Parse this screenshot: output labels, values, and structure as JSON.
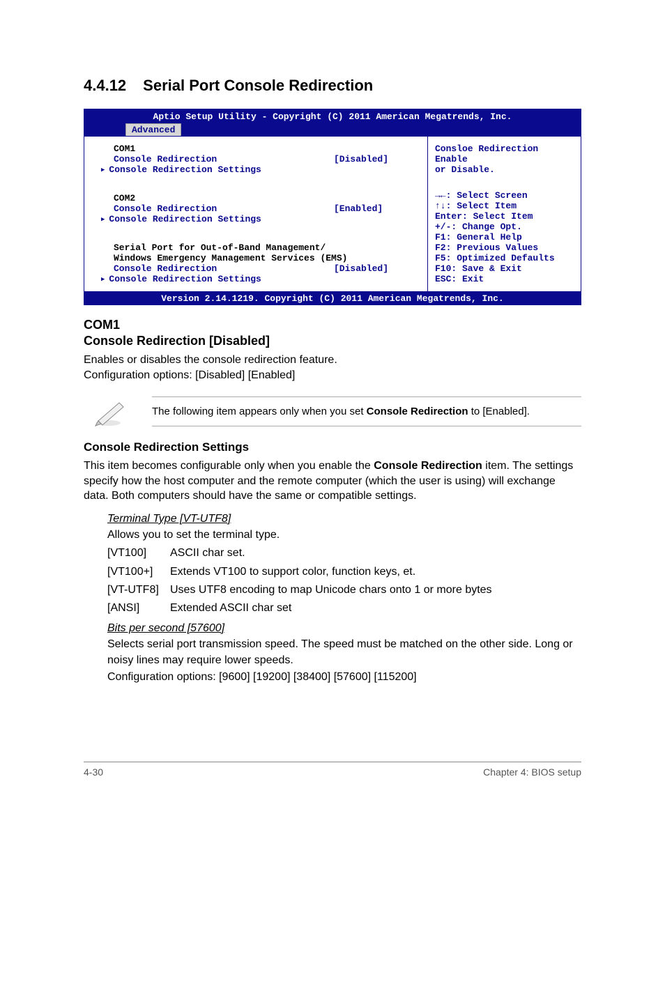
{
  "heading": {
    "num": "4.4.12",
    "title": "Serial Port Console Redirection"
  },
  "bios": {
    "header_title": "Aptio Setup Utility - Copyright (C) 2011 American Megatrends, Inc.",
    "tab": "Advanced",
    "groups": {
      "com1": {
        "label": "COM1",
        "console_redirection": "Console Redirection",
        "value": "[Disabled]",
        "settings": "Console Redirection Settings"
      },
      "com2": {
        "label": "COM2",
        "console_redirection": "Console Redirection",
        "value": "[Enabled]",
        "settings": "Console Redirection Settings"
      },
      "serial_oob_1": "Serial Port for Out-of-Band Management/",
      "serial_oob_2": "Windows Emergency Management Services (EMS)",
      "ems": {
        "label": "Console Redirection",
        "value": "[Disabled]",
        "settings": "Console Redirection Settings"
      }
    },
    "help_top_1": "Consloe Redirection Enable",
    "help_top_2": "or Disable.",
    "help_links": {
      "l1": "→←: Select Screen",
      "l2": "↑↓:  Select Item",
      "l3": "Enter: Select Item",
      "l4": "+/-: Change Opt.",
      "l5": "F1: General Help",
      "l6": "F2: Previous Values",
      "l7": "F5: Optimized Defaults",
      "l8": "F10: Save & Exit",
      "l9": "ESC: Exit"
    },
    "footer": "Version 2.14.1219. Copyright (C) 2011 American Megatrends, Inc."
  },
  "com1_section": {
    "h1": "COM1",
    "h2": "Console Redirection [Disabled]",
    "p1": "Enables or disables the console redirection feature.",
    "p2": "Configuration options: [Disabled] [Enabled]"
  },
  "note": {
    "text1": "The following item appears only when you set ",
    "bold": "Console Redirection",
    "text2": " to [Enabled]."
  },
  "crs": {
    "title": "Console Redirection Settings",
    "p": "This item becomes configurable only when you enable the Console Redirection item. The settings specify how the host computer and the remote computer (which the user is using) will exchange data. Both computers should have the same or compatible settings.",
    "p_pre": "This item becomes configurable only when you enable the ",
    "p_bold": "Console Redirection",
    "p_post": " item. The settings specify how the host computer and the remote computer (which the user is using) will exchange data. Both computers should have the same or compatible settings.",
    "term_type": {
      "title": "Terminal Type [VT-UTF8]",
      "desc": "Allows you to set the terminal type.",
      "opts": {
        "vt100k": "[VT100]",
        "vt100v": "ASCII char set.",
        "vt100pk": "[VT100+]",
        "vt100pv": "Extends VT100 to support color, function keys, et.",
        "vtutf8k": "[VT-UTF8]",
        "vtutf8v": "Uses UTF8 encoding to map Unicode chars onto 1 or more bytes",
        "ansik": "[ANSI]",
        "ansiv": "Extended ASCII char set"
      }
    },
    "bits": {
      "title": "Bits per second [57600]",
      "desc": "Selects serial port transmission speed. The speed must be matched on the other side. Long or noisy lines may require lower speeds.",
      "opts": "Configuration options: [9600] [19200] [38400] [57600] [115200]"
    }
  },
  "footer": {
    "left": "4-30",
    "right": "Chapter 4: BIOS setup"
  }
}
